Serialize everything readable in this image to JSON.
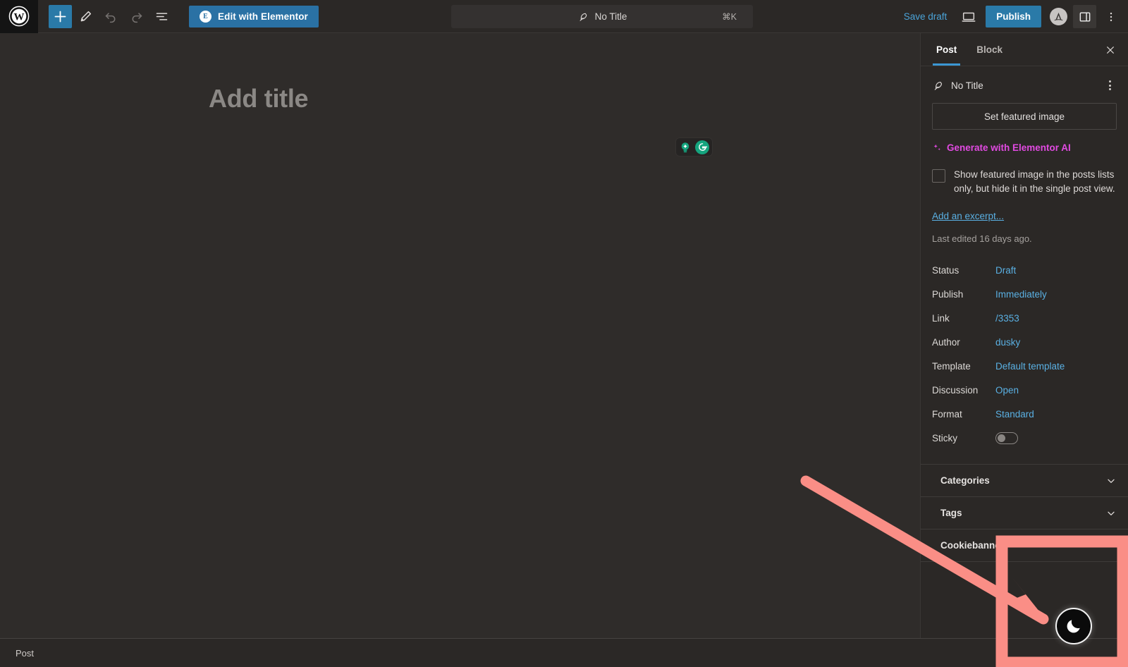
{
  "colors": {
    "accent_blue": "#2a7aa8",
    "link_blue": "#5ab0e3",
    "ai_magenta": "#e14ae1",
    "grammarly_green": "#15a47e",
    "annotation_pink": "#fa8e86",
    "canvas_bg": "#2f2c2a",
    "sidebar_bg": "#2b2826"
  },
  "topbar": {
    "wp_logo": "wordpress-logo",
    "tools": [
      {
        "name": "add-block-button",
        "icon": "plus-icon",
        "label": "Add block",
        "state": "primary"
      },
      {
        "name": "tools-button",
        "icon": "pencil-icon",
        "label": "Tools",
        "state": "normal"
      },
      {
        "name": "undo-button",
        "icon": "undo-icon",
        "label": "Undo",
        "state": "disabled"
      },
      {
        "name": "redo-button",
        "icon": "redo-icon",
        "label": "Redo",
        "state": "disabled"
      },
      {
        "name": "document-overview-button",
        "icon": "list-view-icon",
        "label": "Document Overview",
        "state": "normal"
      }
    ],
    "elementor_button": "Edit with Elementor",
    "elementor_badge": "E",
    "command_bar": {
      "icon": "feather-icon",
      "title": "No Title",
      "shortcut": "⌘K"
    },
    "save_draft": "Save draft",
    "preview_icon": "desktop-preview-icon",
    "publish": "Publish",
    "astra_icon": "astra-logo-icon",
    "settings_icon": "sidebar-panel-icon",
    "options_icon": "kebab-menu-icon"
  },
  "canvas": {
    "title_placeholder": "Add title",
    "grammarly": {
      "bulb_icon": "grammarly-bulb-icon",
      "logo_icon": "grammarly-g-icon",
      "label": "Grammarly"
    }
  },
  "sidebar": {
    "tabs": [
      {
        "label": "Post",
        "active": true
      },
      {
        "label": "Block",
        "active": false
      }
    ],
    "close_icon": "close-icon",
    "post_type": {
      "icon": "feather-icon",
      "label": "No Title",
      "kebab": "kebab-menu-icon"
    },
    "featured_image_button": "Set featured image",
    "ai_link": "Generate with Elementor AI",
    "ai_icon": "sparkles-icon",
    "checkbox": {
      "checked": false,
      "label": "Show featured image in the posts lists only, but hide it in the single post view."
    },
    "excerpt_link": "Add an excerpt...",
    "last_edited": "Last edited 16 days ago.",
    "meta": [
      {
        "key": "Status",
        "value": "Draft",
        "type": "link"
      },
      {
        "key": "Publish",
        "value": "Immediately",
        "type": "link"
      },
      {
        "key": "Link",
        "value": "/3353",
        "type": "link"
      },
      {
        "key": "Author",
        "value": "dusky",
        "type": "link"
      },
      {
        "key": "Template",
        "value": "Default template",
        "type": "link"
      },
      {
        "key": "Discussion",
        "value": "Open",
        "type": "link"
      },
      {
        "key": "Format",
        "value": "Standard",
        "type": "link"
      },
      {
        "key": "Sticky",
        "value": "",
        "type": "toggle"
      }
    ],
    "panels": [
      {
        "label": "Categories",
        "expanded": false,
        "icon": "chevron-down-icon"
      },
      {
        "label": "Tags",
        "expanded": false,
        "icon": "chevron-down-icon"
      },
      {
        "label": "Cookiebanner",
        "expanded": true,
        "icon": "chevron-up-icon"
      }
    ]
  },
  "annotation": {
    "arrow": "pink-arrow-pointing-to-dark-mode-toggle",
    "highlight_box": "pink-rectangle-highlight",
    "dark_mode_toggle_icon": "moon-icon"
  },
  "bottombar": {
    "breadcrumb": "Post"
  }
}
